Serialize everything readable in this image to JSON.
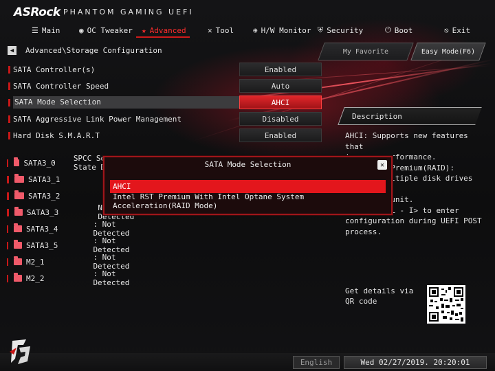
{
  "brand": {
    "name": "ASRock",
    "product": "PHANTOM GAMING UEFI"
  },
  "colors": {
    "accent": "#e3161c",
    "active_tab": "#ff2d2d",
    "background": "#0b0b0c"
  },
  "nav": [
    {
      "label": "Main",
      "icon": "list-icon"
    },
    {
      "label": "OC Tweaker",
      "icon": "flame-icon"
    },
    {
      "label": "Advanced",
      "icon": "star-icon",
      "active": true
    },
    {
      "label": "Tool",
      "icon": "tools-icon"
    },
    {
      "label": "H/W Monitor",
      "icon": "monitor-icon"
    },
    {
      "label": "Security",
      "icon": "shield-icon"
    },
    {
      "label": "Boot",
      "icon": "power-icon"
    },
    {
      "label": "Exit",
      "icon": "exit-icon"
    }
  ],
  "breadcrumb": "Advanced\\Storage Configuration",
  "buttons": {
    "favorite": "My Favorite",
    "easy_mode": "Easy Mode(F6)"
  },
  "settings": [
    {
      "label": "SATA Controller(s)",
      "value": "Enabled"
    },
    {
      "label": "SATA Controller Speed",
      "value": "Auto"
    },
    {
      "label": "SATA Mode Selection",
      "value": "AHCI",
      "selected": true
    },
    {
      "label": "SATA Aggressive Link Power Management",
      "value": "Disabled"
    },
    {
      "label": "Hard Disk S.M.A.R.T",
      "value": "Enabled"
    }
  ],
  "drives": [
    {
      "name": "SATA3_0",
      "value": "SPCC Solid State Disk"
    },
    {
      "name": "SATA3_1",
      "value": ""
    },
    {
      "name": "SATA3_2",
      "value": ""
    },
    {
      "name": "SATA3_3",
      "value": "Not Detected"
    },
    {
      "name": "SATA3_4",
      "value": ": Not Detected"
    },
    {
      "name": "SATA3_5",
      "value": ": Not Detected"
    },
    {
      "name": "M2_1",
      "value": ": Not Detected"
    },
    {
      "name": "M2_2",
      "value": ": Not Detected"
    }
  ],
  "description": {
    "title": "Description",
    "body": "AHCI: Supports new features that\nimprove performance.\nIntel RST Premium(RAID):\nCombine multiple disk drives into\na logical unit.\nPress <CTRL - I> to enter\nconfiguration during UEFI POST process.",
    "qr_text": "Get details via QR code"
  },
  "dialog": {
    "title": "SATA Mode Selection",
    "options": [
      {
        "label": "AHCI",
        "selected": true
      },
      {
        "label": "Intel RST Premium With Intel Optane System Acceleration(RAID Mode)"
      }
    ]
  },
  "footer": {
    "language": "English",
    "datetime": "Wed 02/27/2019. 20:20:01"
  }
}
